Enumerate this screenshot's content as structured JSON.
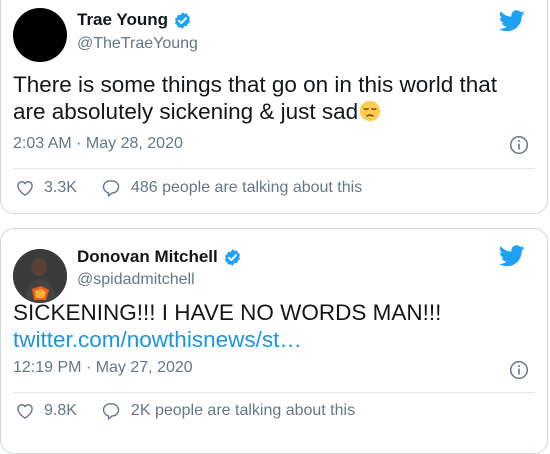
{
  "tweets": [
    {
      "author_name": "Trae Young",
      "handle": "@TheTraeYoung",
      "text": "There is some things that go on in this world that are absolutely sickening & just sad",
      "emoji_icon": "pensive-face-emoji",
      "timestamp": "2:03 AM · May 28, 2020",
      "likes": "3.3K",
      "talking": "486 people are talking about this"
    },
    {
      "author_name": "Donovan Mitchell",
      "handle": "@spidadmitchell",
      "text": "SICKENING!!! I HAVE NO WORDS MAN!!!",
      "link": "twitter.com/nowthisnews/st…",
      "timestamp": "12:19 PM · May 27, 2020",
      "likes": "9.8K",
      "talking": "2K people are talking about this"
    }
  ],
  "colors": {
    "twitter_blue": "#1da1f2",
    "link_blue": "#1b95e0",
    "text_dark": "#14171a",
    "text_gray": "#657786",
    "border": "#cfd9de"
  }
}
